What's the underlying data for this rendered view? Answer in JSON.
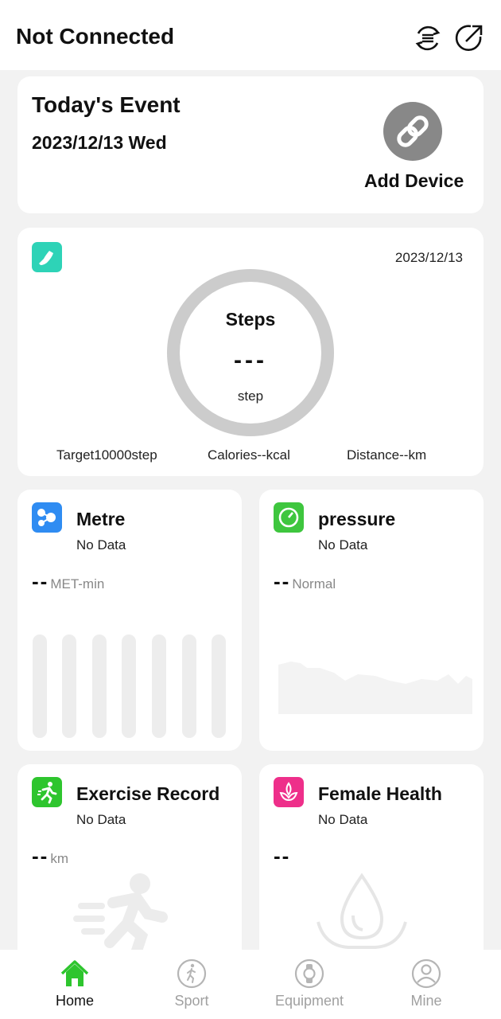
{
  "header": {
    "title": "Not Connected",
    "sync_icon": "sync-list-icon",
    "share_icon": "share-icon"
  },
  "event": {
    "title": "Today's Event",
    "date": "2023/12/13 Wed",
    "add_device_label": "Add Device",
    "link_icon": "link-icon"
  },
  "steps": {
    "date": "2023/12/13",
    "title": "Steps",
    "value": "---",
    "unit": "step",
    "target": "Target10000step",
    "calories": "Calories--kcal",
    "distance": "Distance--km",
    "icon": "shoe-icon",
    "accent": "#2ed3b7"
  },
  "tiles": {
    "metre": {
      "title": "Metre",
      "status": "No Data",
      "value": "--",
      "unit": "MET-min",
      "icon": "metre-icon",
      "color": "#2f8cf2"
    },
    "pressure": {
      "title": "pressure",
      "status": "No Data",
      "value": "--",
      "unit": "Normal",
      "icon": "gauge-icon",
      "color": "#3ec63e"
    },
    "exercise": {
      "title": "Exercise Record",
      "status": "No Data",
      "value": "--",
      "unit": "km",
      "icon": "runner-icon",
      "color": "#2ec52e"
    },
    "female": {
      "title": "Female Health",
      "status": "No Data",
      "value": "--",
      "icon": "lotus-icon",
      "color": "#ee2f8a"
    }
  },
  "nav": {
    "items": [
      {
        "label": "Home",
        "icon": "home-icon",
        "active": true
      },
      {
        "label": "Sport",
        "icon": "sport-icon",
        "active": false
      },
      {
        "label": "Equipment",
        "icon": "watch-icon",
        "active": false
      },
      {
        "label": "Mine",
        "icon": "person-icon",
        "active": false
      }
    ],
    "active_color": "#2ec52e"
  }
}
